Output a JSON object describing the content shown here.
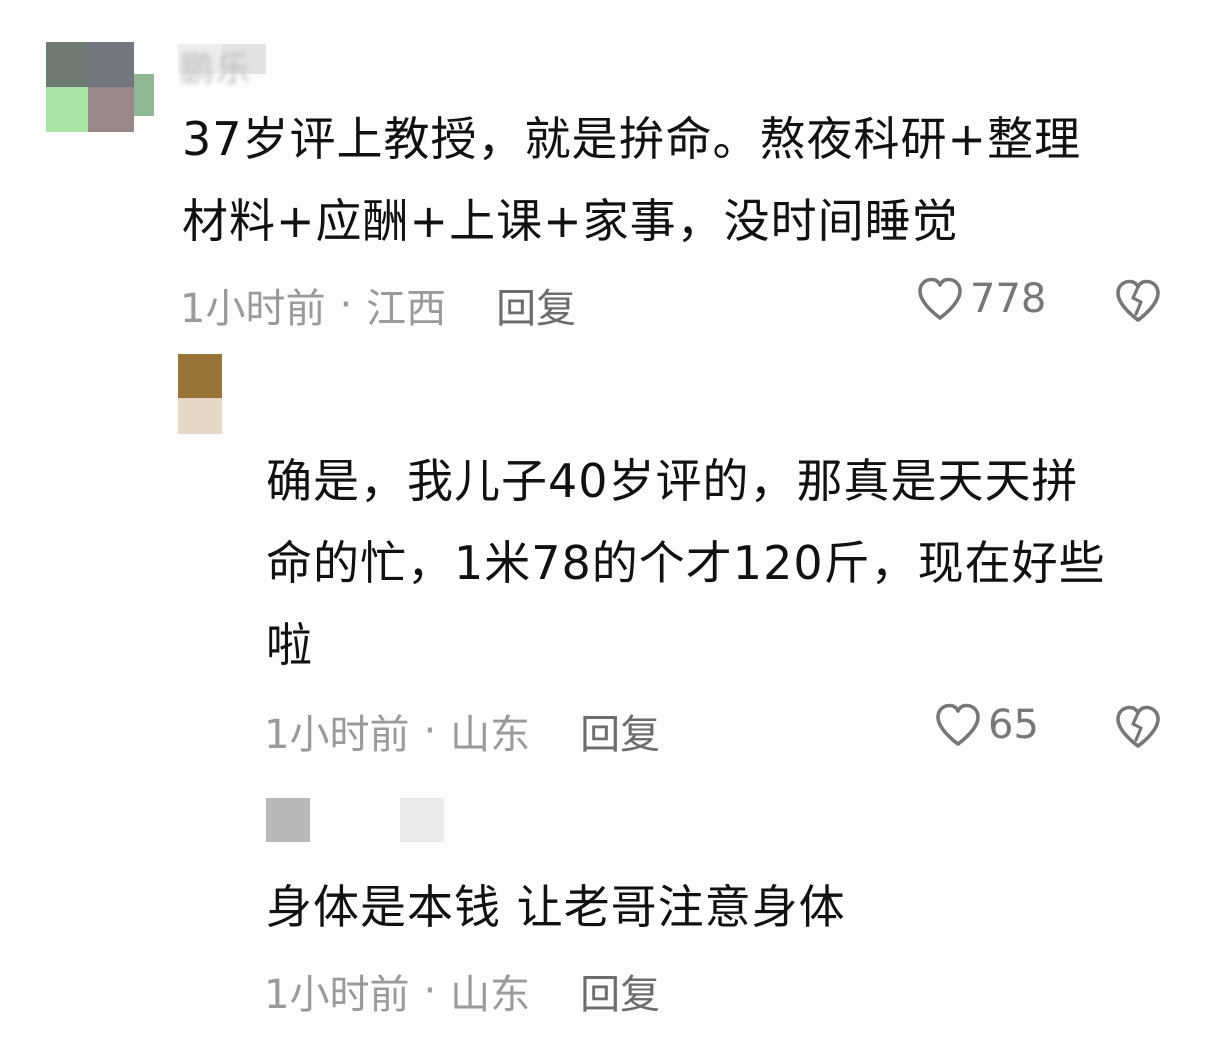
{
  "comments": [
    {
      "username": "鹏乐",
      "text": "37岁评上教授，就是拚命。熬夜科研+整理材料+应酬+上课+家事，没时间睡觉",
      "line1": "37岁评上教授，就是拚命。熬夜科研+整理",
      "line2": "材料+应酬+上课+家事，没时间睡觉",
      "time": "1小时前",
      "separator": "·",
      "location": "江西",
      "reply_label": "回复",
      "likes": "778"
    },
    {
      "line1": "确是，我儿子40岁评的，那真是天天拼",
      "line2": "命的忙，1米78的个才120斤，现在好些",
      "line3": "啦",
      "time": "1小时前",
      "separator": "·",
      "location": "山东",
      "reply_label": "回复",
      "likes": "65"
    },
    {
      "line1": "身体是本钱 让老哥注意身体",
      "time": "1小时前",
      "separator": "·",
      "location": "山东",
      "reply_label": "回复"
    }
  ],
  "icons": {
    "like": "heart-outline-icon",
    "dislike": "broken-heart-icon"
  },
  "colors": {
    "text": "#111111",
    "meta": "#9a9a9a",
    "reply": "#6c6c6c",
    "icon": "#777777"
  }
}
